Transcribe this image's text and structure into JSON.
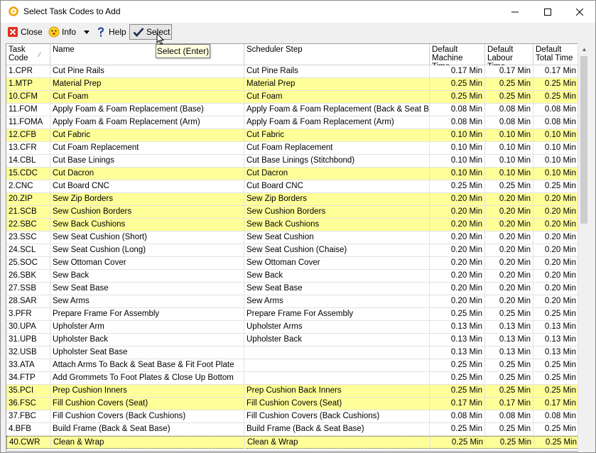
{
  "window": {
    "title": "Select Task Codes to Add"
  },
  "toolbar": {
    "close_label": "Close",
    "info_label": "Info",
    "help_label": "Help",
    "select_label": "Select"
  },
  "tooltip": {
    "text": "Select (Enter)"
  },
  "grid": {
    "headers": {
      "task_code_1": "Task",
      "task_code_2": "Code",
      "name": "Name",
      "scheduler_step": "Scheduler Step",
      "machine_1": "Default",
      "machine_2": "Machine Time",
      "labour_1": "Default",
      "labour_2": "Labour Time",
      "total_1": "Default",
      "total_2": "Total Time"
    },
    "rows": [
      {
        "code": "1.CPR",
        "name": "Cut Pine Rails",
        "step": "Cut Pine Rails",
        "machine": "0.17 Min",
        "labour": "0.17 Min",
        "total": "0.17 Min",
        "highlight": false
      },
      {
        "code": "1.MTP",
        "name": "Material Prep",
        "step": "Material Prep",
        "machine": "0.25 Min",
        "labour": "0.25 Min",
        "total": "0.25 Min",
        "highlight": true
      },
      {
        "code": "10.CFM",
        "name": "Cut Foam",
        "step": "Cut Foam",
        "machine": "0.25 Min",
        "labour": "0.25 Min",
        "total": "0.25 Min",
        "highlight": true
      },
      {
        "code": "11.FOM",
        "name": "Apply Foam & Foam Replacement (Base)",
        "step": "Apply Foam & Foam Replacement (Back & Seat Base)",
        "machine": "0.08 Min",
        "labour": "0.08 Min",
        "total": "0.08 Min",
        "highlight": false
      },
      {
        "code": "11.FOMA",
        "name": "Apply Foam & Foam Replacement (Arm)",
        "step": "Apply Foam & Foam Replacement (Arm)",
        "machine": "0.08 Min",
        "labour": "0.08 Min",
        "total": "0.08 Min",
        "highlight": false
      },
      {
        "code": "12.CFB",
        "name": "Cut Fabric",
        "step": "Cut Fabric",
        "machine": "0.10 Min",
        "labour": "0.10 Min",
        "total": "0.10 Min",
        "highlight": true
      },
      {
        "code": "13.CFR",
        "name": "Cut Foam Replacement",
        "step": "Cut Foam Replacement",
        "machine": "0.10 Min",
        "labour": "0.10 Min",
        "total": "0.10 Min",
        "highlight": false
      },
      {
        "code": "14.CBL",
        "name": "Cut Base Linings",
        "step": "Cut Base Linings (Stitchbond)",
        "machine": "0.10 Min",
        "labour": "0.10 Min",
        "total": "0.10 Min",
        "highlight": false
      },
      {
        "code": "15.CDC",
        "name": "Cut Dacron",
        "step": "Cut Dacron",
        "machine": "0.10 Min",
        "labour": "0.10 Min",
        "total": "0.10 Min",
        "highlight": true
      },
      {
        "code": "2.CNC",
        "name": "Cut Board CNC",
        "step": "Cut Board CNC",
        "machine": "0.25 Min",
        "labour": "0.25 Min",
        "total": "0.25 Min",
        "highlight": false
      },
      {
        "code": "20.ZIP",
        "name": "Sew Zip Borders",
        "step": "Sew Zip Borders",
        "machine": "0.20 Min",
        "labour": "0.20 Min",
        "total": "0.20 Min",
        "highlight": true
      },
      {
        "code": "21.SCB",
        "name": "Sew Cushion Borders",
        "step": "Sew Cushion Borders",
        "machine": "0.20 Min",
        "labour": "0.20 Min",
        "total": "0.20 Min",
        "highlight": true
      },
      {
        "code": "22.SBC",
        "name": "Sew Back Cushions",
        "step": "Sew Back Cushions",
        "machine": "0.20 Min",
        "labour": "0.20 Min",
        "total": "0.20 Min",
        "highlight": true
      },
      {
        "code": "23.SSC",
        "name": "Sew Seat Cushion (Short)",
        "step": "Sew Seat Cushion",
        "machine": "0.20 Min",
        "labour": "0.20 Min",
        "total": "0.20 Min",
        "highlight": false
      },
      {
        "code": "24.SCL",
        "name": "Sew Seat Cushion (Long)",
        "step": "Sew Seat Cushion (Chaise)",
        "machine": "0.20 Min",
        "labour": "0.20 Min",
        "total": "0.20 Min",
        "highlight": false
      },
      {
        "code": "25.SOC",
        "name": "Sew Ottoman Cover",
        "step": "Sew Ottoman Cover",
        "machine": "0.20 Min",
        "labour": "0.20 Min",
        "total": "0.20 Min",
        "highlight": false
      },
      {
        "code": "26.SBK",
        "name": "Sew Back",
        "step": "Sew Back",
        "machine": "0.20 Min",
        "labour": "0.20 Min",
        "total": "0.20 Min",
        "highlight": false
      },
      {
        "code": "27.SSB",
        "name": "Sew Seat Base",
        "step": "Sew Seat Base",
        "machine": "0.20 Min",
        "labour": "0.20 Min",
        "total": "0.20 Min",
        "highlight": false
      },
      {
        "code": "28.SAR",
        "name": "Sew Arms",
        "step": "Sew Arms",
        "machine": "0.20 Min",
        "labour": "0.20 Min",
        "total": "0.20 Min",
        "highlight": false
      },
      {
        "code": "3.PFR",
        "name": "Prepare Frame For Assembly",
        "step": "Prepare Frame For Assembly",
        "machine": "0.25 Min",
        "labour": "0.25 Min",
        "total": "0.25 Min",
        "highlight": false
      },
      {
        "code": "30.UPA",
        "name": "Upholster Arm",
        "step": "Upholster Arms",
        "machine": "0.13 Min",
        "labour": "0.13 Min",
        "total": "0.13 Min",
        "highlight": false
      },
      {
        "code": "31.UPB",
        "name": "Upholster Back",
        "step": "Upholster Back",
        "machine": "0.13 Min",
        "labour": "0.13 Min",
        "total": "0.13 Min",
        "highlight": false
      },
      {
        "code": "32.USB",
        "name": "Upholster Seat Base",
        "step": "",
        "machine": "0.13 Min",
        "labour": "0.13 Min",
        "total": "0.13 Min",
        "highlight": false
      },
      {
        "code": "33.ATA",
        "name": "Attach Arms To Back & Seat Base & Fit Foot Plate",
        "step": "",
        "machine": "0.25 Min",
        "labour": "0.25 Min",
        "total": "0.25 Min",
        "highlight": false
      },
      {
        "code": "34.FTP",
        "name": "Add Grommets To Foot Plates & Close Up Bottom",
        "step": "",
        "machine": "0.25 Min",
        "labour": "0.25 Min",
        "total": "0.25 Min",
        "highlight": false
      },
      {
        "code": "35.PCI",
        "name": "Prep Cushion Inners",
        "step": "Prep Cushion Back Inners",
        "machine": "0.25 Min",
        "labour": "0.25 Min",
        "total": "0.25 Min",
        "highlight": true
      },
      {
        "code": "36.FSC",
        "name": "Fill Cushion Covers (Seat)",
        "step": "Fill Cushion Covers (Seat)",
        "machine": "0.17 Min",
        "labour": "0.17 Min",
        "total": "0.17 Min",
        "highlight": true
      },
      {
        "code": "37.FBC",
        "name": "Fill Cushion Covers (Back Cushions)",
        "step": "Fill Cushion Covers (Back Cushions)",
        "machine": "0.08 Min",
        "labour": "0.08 Min",
        "total": "0.08 Min",
        "highlight": false
      },
      {
        "code": "4.BFB",
        "name": "Build Frame (Back & Seat Base)",
        "step": "Build Frame (Back & Seat Base)",
        "machine": "0.25 Min",
        "labour": "0.25 Min",
        "total": "0.25 Min",
        "highlight": false
      },
      {
        "code": "40.CWR",
        "name": "Clean & Wrap",
        "step": "Clean & Wrap",
        "machine": "0.25 Min",
        "labour": "0.25 Min",
        "total": "0.25 Min",
        "highlight": true
      }
    ]
  },
  "colors": {
    "highlight_row": "#ffff99",
    "plain_row": "#ffffff",
    "tooltip_bg": "#ffffe1"
  },
  "icons": {
    "app": "app-logo-icon",
    "close": "close-icon",
    "info": "info-smiley-icon",
    "help": "help-question-icon",
    "select": "checkmark-icon"
  }
}
